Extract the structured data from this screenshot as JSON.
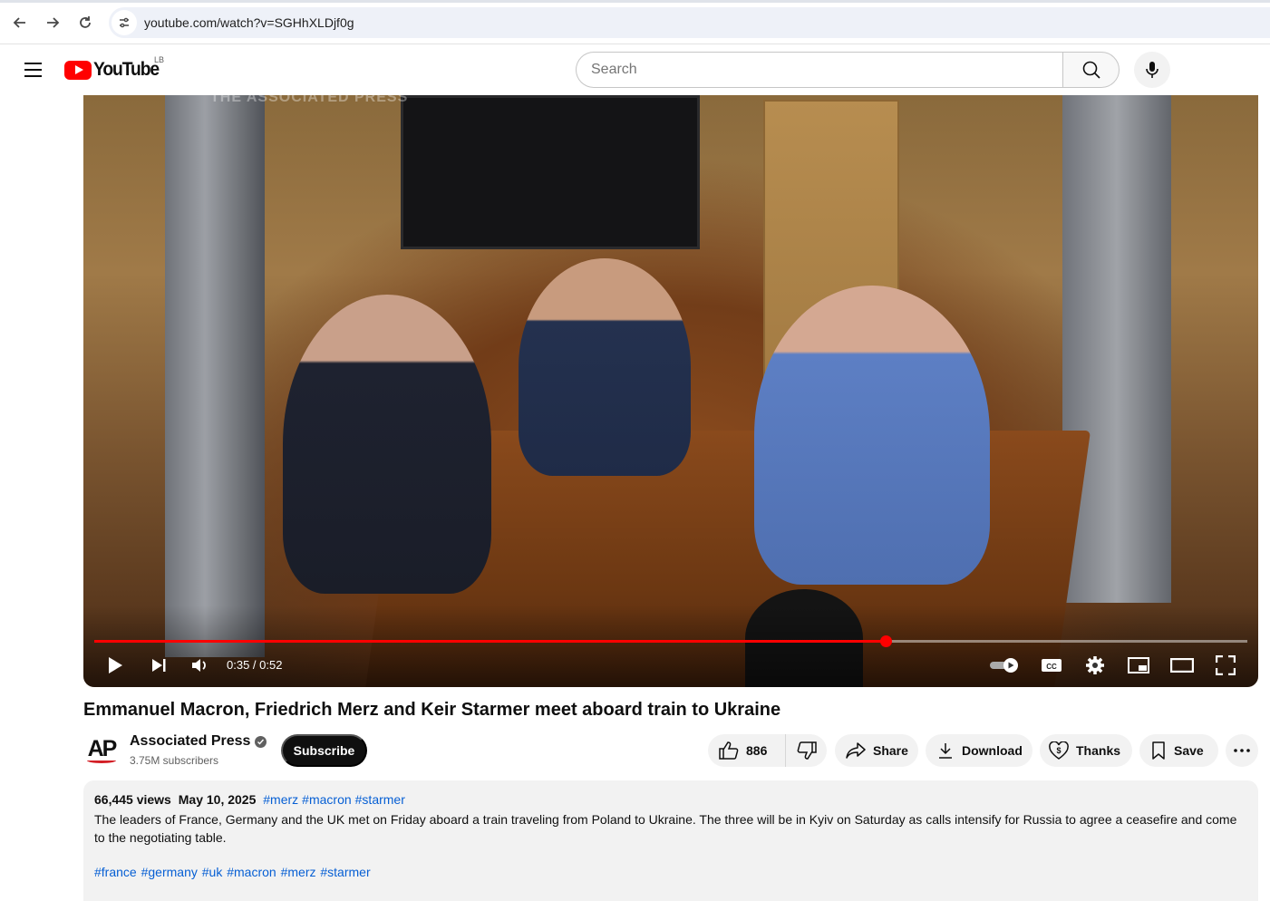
{
  "browser": {
    "url": "youtube.com/watch?v=SGHhXLDjf0g"
  },
  "header": {
    "logo_text": "YouTube",
    "region": "LB",
    "search_placeholder": "Search"
  },
  "player": {
    "watermark": "THE ASSOCIATED PRESS",
    "time": "0:35 / 0:52",
    "progress": 0.686
  },
  "video": {
    "title": "Emmanuel Macron, Friedrich Merz and Keir Starmer meet aboard train to Ukraine"
  },
  "channel": {
    "name": "Associated Press",
    "subscribers": "3.75M subscribers",
    "avatar_text": "AP",
    "subscribe_label": "Subscribe"
  },
  "actions": {
    "likes": "886",
    "share": "Share",
    "download": "Download",
    "thanks": "Thanks",
    "save": "Save"
  },
  "description": {
    "views": "66,445 views",
    "date": "May 10, 2025",
    "top_tags": [
      "#merz",
      "#macron",
      "#starmer"
    ],
    "text": "The leaders of France, Germany and the UK met on Friday aboard a train traveling from Poland to Ukraine. The three will be in Kyiv on Saturday as calls intensify for Russia to agree a ceasefire and come to the negotiating table.",
    "bottom_tags": [
      "#france",
      "#germany",
      "#uk",
      "#macron",
      "#merz",
      "#starmer"
    ]
  },
  "colors": {
    "accent_red": "#ff0000",
    "link_blue": "#065fd4"
  }
}
